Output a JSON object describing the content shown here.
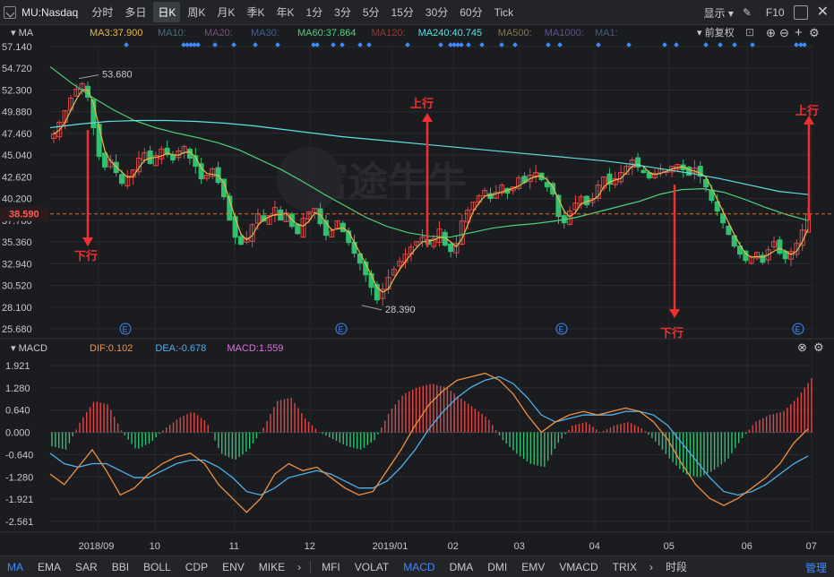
{
  "toolbar": {
    "symbol": "MU:Nasdaq",
    "periods": [
      "分时",
      "多日",
      "日K",
      "周K",
      "月K",
      "季K",
      "年K",
      "1分",
      "3分",
      "5分",
      "15分",
      "30分",
      "60分",
      "Tick"
    ],
    "active_period": "日K",
    "display_label": "显示",
    "f10_label": "F10"
  },
  "bottom": {
    "main_indicators": [
      "MA",
      "EMA",
      "SAR",
      "BBI",
      "BOLL",
      "CDP",
      "ENV",
      "MIKE"
    ],
    "sub_indicators": [
      "MFI",
      "VOLAT",
      "MACD",
      "DMA",
      "DMI",
      "EMV",
      "VMACD",
      "TRIX"
    ],
    "active_main": "MA",
    "active_sub": "MACD",
    "period_label": "时段",
    "manage_label": "管理"
  },
  "chart_data": [
    {
      "type": "candlestick",
      "indicator_label": "MA",
      "legend": [
        {
          "text": "MA3:37.900",
          "color": "#e8b84a"
        },
        {
          "text": "MA10:",
          "color": "#3b6f8a"
        },
        {
          "text": "MA20:",
          "color": "#7a4f7c"
        },
        {
          "text": "MA30:",
          "color": "#3a5f9a"
        },
        {
          "text": "MA60:37.864",
          "color": "#4fcf7a"
        },
        {
          "text": "MA120:",
          "color": "#8a3a3a"
        },
        {
          "text": "MA240:40.745",
          "color": "#5fe0e0"
        },
        {
          "text": "MA500:",
          "color": "#8a7a3a"
        },
        {
          "text": "MA1000:",
          "color": "#5a4f9a"
        },
        {
          "text": "MA1:",
          "color": "#3a5f7a"
        }
      ],
      "adjust_label": "前复权",
      "yticks": [
        57.14,
        54.72,
        52.3,
        49.88,
        47.46,
        45.04,
        42.62,
        40.2,
        37.78,
        35.36,
        32.94,
        30.52,
        28.1,
        25.68
      ],
      "ylim": [
        25.68,
        57.14
      ],
      "current_price": 38.59,
      "high_label": "53.680",
      "low_label": "28.390",
      "annotations": [
        "下行",
        "上行",
        "下行",
        "上行"
      ],
      "earnings_marker": "E",
      "close_series": [
        47.5,
        48.8,
        50.1,
        51.5,
        52.5,
        53.1,
        51.6,
        48.2,
        45.0,
        43.8,
        44.6,
        43.2,
        42.0,
        42.8,
        43.5,
        44.8,
        45.4,
        44.2,
        45.1,
        45.8,
        45.2,
        44.6,
        45.6,
        46.1,
        44.8,
        43.9,
        42.5,
        42.9,
        43.6,
        42.1,
        40.5,
        37.9,
        36.0,
        35.2,
        35.9,
        37.4,
        38.6,
        37.8,
        38.4,
        39.3,
        37.9,
        38.7,
        37.2,
        36.4,
        38.1,
        38.8,
        39.2,
        37.5,
        36.2,
        36.7,
        37.8,
        36.6,
        35.4,
        34.2,
        33.1,
        31.8,
        30.4,
        29.0,
        30.2,
        31.5,
        32.4,
        33.3,
        34.1,
        34.9,
        35.5,
        36.0,
        35.2,
        35.8,
        36.9,
        35.1,
        34.4,
        35.3,
        37.8,
        39.0,
        39.9,
        40.6,
        41.2,
        40.3,
        41.0,
        41.8,
        40.9,
        41.6,
        42.6,
        42.1,
        42.9,
        43.2,
        42.4,
        41.6,
        40.8,
        38.3,
        37.6,
        38.9,
        39.8,
        40.5,
        39.6,
        40.3,
        41.8,
        42.7,
        41.9,
        42.5,
        43.2,
        43.9,
        44.6,
        43.8,
        43.2,
        42.6,
        43.1,
        43.6,
        43.3,
        43.9,
        44.1,
        43.5,
        42.9,
        43.7,
        42.8,
        41.6,
        40.1,
        38.9,
        37.6,
        36.3,
        35.0,
        34.1,
        33.4,
        33.8,
        34.3,
        33.2,
        34.6,
        35.5,
        34.2,
        33.6,
        34.4,
        35.3,
        36.8,
        38.59
      ],
      "ma_series": [
        {
          "name": "MA60",
          "color": "#4fcf7a",
          "values": [
            55.0,
            53.2,
            51.6,
            50.2,
            49.0,
            48.2,
            47.6,
            47.1,
            46.5,
            45.7,
            44.6,
            43.5,
            42.2,
            40.8,
            39.5,
            38.2,
            37.2,
            36.5,
            36.1,
            36.0,
            36.5,
            37.0,
            37.3,
            37.5,
            37.8,
            38.2,
            38.8,
            39.4,
            40.0,
            40.8,
            41.3,
            41.4,
            41.0,
            40.2,
            39.3,
            38.5,
            37.86
          ]
        },
        {
          "name": "MA240",
          "color": "#5fe0e0",
          "values": [
            48.2,
            48.6,
            48.9,
            49.0,
            49.0,
            48.9,
            48.7,
            48.4,
            48.0,
            47.6,
            47.2,
            46.9,
            46.6,
            46.3,
            46.0,
            45.7,
            45.4,
            45.1,
            44.8,
            44.5,
            44.1,
            43.6,
            43.1,
            42.5,
            41.8,
            41.1,
            40.75
          ]
        }
      ]
    },
    {
      "type": "macd",
      "indicator_label": "MACD",
      "legend": [
        {
          "text": "DIF:0.102",
          "color": "#f09040"
        },
        {
          "text": "DEA:-0.678",
          "color": "#4fb0e8"
        },
        {
          "text": "MACD:1.559",
          "color": "#e070e0"
        }
      ],
      "yticks": [
        1.921,
        1.28,
        0.64,
        0.0,
        -0.64,
        -1.28,
        -1.921,
        -2.561
      ],
      "ylim": [
        -2.561,
        1.921
      ],
      "dif": [
        -1.2,
        -1.5,
        -1.0,
        -0.5,
        -1.1,
        -1.8,
        -1.6,
        -1.2,
        -0.9,
        -0.7,
        -0.6,
        -0.9,
        -1.5,
        -1.9,
        -2.3,
        -1.9,
        -1.2,
        -0.9,
        -1.1,
        -1.0,
        -1.3,
        -1.6,
        -1.8,
        -1.7,
        -1.1,
        -0.5,
        0.2,
        0.8,
        1.2,
        1.5,
        1.6,
        1.7,
        1.5,
        1.1,
        0.5,
        0.0,
        0.3,
        0.5,
        0.6,
        0.5,
        0.6,
        0.7,
        0.6,
        0.3,
        -0.2,
        -0.9,
        -1.5,
        -1.9,
        -2.1,
        -1.9,
        -1.6,
        -1.3,
        -0.9,
        -0.3,
        0.102
      ],
      "dea": [
        -0.6,
        -0.9,
        -1.0,
        -0.9,
        -0.9,
        -1.1,
        -1.3,
        -1.3,
        -1.1,
        -0.9,
        -0.8,
        -0.8,
        -1.0,
        -1.3,
        -1.7,
        -1.8,
        -1.6,
        -1.3,
        -1.2,
        -1.1,
        -1.2,
        -1.4,
        -1.6,
        -1.6,
        -1.4,
        -1.0,
        -0.5,
        0.1,
        0.6,
        1.0,
        1.3,
        1.5,
        1.6,
        1.4,
        1.0,
        0.5,
        0.3,
        0.4,
        0.5,
        0.5,
        0.5,
        0.6,
        0.6,
        0.5,
        0.2,
        -0.3,
        -0.8,
        -1.3,
        -1.7,
        -1.8,
        -1.7,
        -1.5,
        -1.2,
        -0.9,
        -0.678
      ],
      "hist": [
        -0.4,
        -0.5,
        0.3,
        0.9,
        0.8,
        0.0,
        -0.5,
        -0.3,
        0.1,
        0.4,
        0.6,
        0.3,
        -0.6,
        -0.8,
        -0.5,
        0.1,
        0.9,
        1.0,
        0.4,
        0.0,
        -0.2,
        -0.4,
        -0.5,
        -0.2,
        0.6,
        1.1,
        1.3,
        1.4,
        1.3,
        1.0,
        0.7,
        0.4,
        -0.2,
        -0.6,
        -0.9,
        -1.0,
        -0.3,
        0.2,
        0.3,
        0.0,
        0.2,
        0.3,
        0.1,
        -0.3,
        -0.8,
        -1.2,
        -1.3,
        -1.1,
        -0.8,
        -0.2,
        0.3,
        0.5,
        0.6,
        1.0,
        1.559
      ]
    }
  ],
  "xaxis": {
    "labels": [
      "2018/09",
      "10",
      "11",
      "12",
      "2019/01",
      "02",
      "03",
      "04",
      "05",
      "06",
      "07"
    ]
  }
}
